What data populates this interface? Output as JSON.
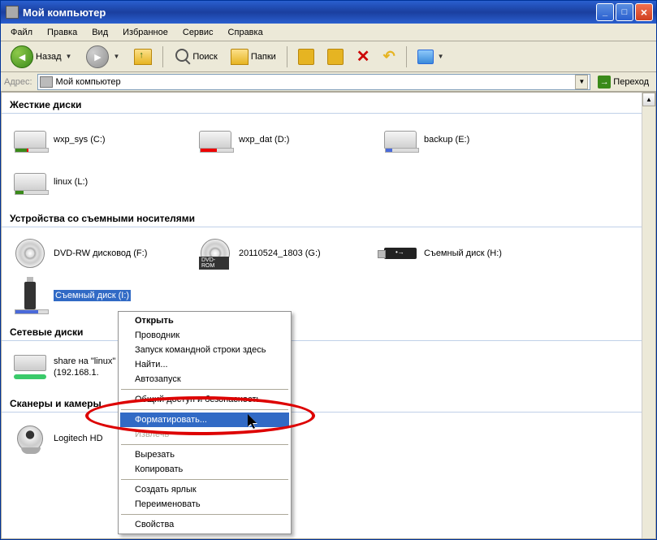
{
  "window": {
    "title": "Мой компьютер"
  },
  "menubar": [
    "Файл",
    "Правка",
    "Вид",
    "Избранное",
    "Сервис",
    "Справка"
  ],
  "toolbar": {
    "back": "Назад",
    "search": "Поиск",
    "folders": "Папки"
  },
  "addressbar": {
    "label": "Адрес:",
    "value": "Мой компьютер",
    "go": "Переход"
  },
  "groups": {
    "hdd": {
      "title": "Жесткие диски",
      "items": [
        {
          "label": "wxp_sys (C:)",
          "icon": "c"
        },
        {
          "label": "wxp_dat (D:)",
          "icon": "d"
        },
        {
          "label": "backup (E:)",
          "icon": "e"
        },
        {
          "label": "linux (L:)",
          "icon": "l"
        }
      ]
    },
    "removable": {
      "title": "Устройства со съемными носителями",
      "items": [
        {
          "label": "DVD-RW дисковод (F:)",
          "icon": "dvd"
        },
        {
          "label": "20110524_1803 (G:)",
          "icon": "dvdrom"
        },
        {
          "label": "Съемный диск (H:)",
          "icon": "usb"
        },
        {
          "label": "Съемный диск (I:)",
          "icon": "usbv",
          "selected": true
        }
      ]
    },
    "network": {
      "title": "Сетевые диски",
      "items": [
        {
          "label": "share на \"linux\"",
          "sub": "(192.168.1."
        }
      ]
    },
    "scanners": {
      "title": "Сканеры и камеры",
      "items": [
        {
          "label": "Logitech HD"
        }
      ]
    }
  },
  "context_menu": [
    {
      "label": "Открыть",
      "bold": true
    },
    {
      "label": "Проводник"
    },
    {
      "label": "Запуск командной строки здесь"
    },
    {
      "label": "Найти..."
    },
    {
      "label": "Автозапуск"
    },
    {
      "sep": true
    },
    {
      "label": "Общий доступ и безопасность..."
    },
    {
      "sep": true
    },
    {
      "label": "Форматировать...",
      "highlight": true
    },
    {
      "label": "Извлечь",
      "disabled": true
    },
    {
      "sep": true
    },
    {
      "label": "Вырезать"
    },
    {
      "label": "Копировать"
    },
    {
      "sep": true
    },
    {
      "label": "Создать ярлык"
    },
    {
      "label": "Переименовать"
    },
    {
      "sep": true
    },
    {
      "label": "Свойства"
    }
  ]
}
